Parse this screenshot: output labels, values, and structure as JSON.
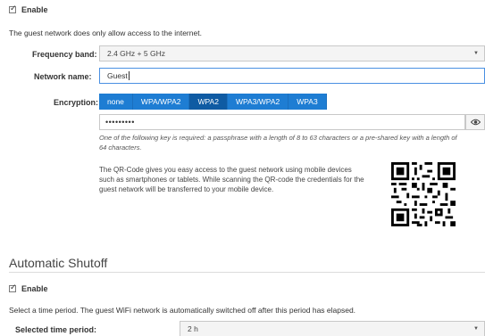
{
  "guest": {
    "enable_label": "Enable",
    "description": "The guest network does only allow access to the internet.",
    "frequency": {
      "label": "Frequency band:",
      "value": "2.4 GHz + 5 GHz"
    },
    "network_name": {
      "label": "Network name:",
      "value": "Guest"
    },
    "encryption": {
      "label": "Encryption:",
      "options": [
        "none",
        "WPA/WPA2",
        "WPA2",
        "WPA3/WPA2",
        "WPA3"
      ],
      "selected": "WPA2"
    },
    "password_mask": "•••••••••",
    "key_hint": "One of the following key is required: a passphrase with a length of 8 to 63 characters or a pre-shared key with a length of 64 characters.",
    "qr_text": "The QR-Code gives you easy access to the guest network using mobile devices such as smartphones or tablets. While scanning the QR-code the credentials for the guest network will be transferred to your mobile device."
  },
  "shutoff": {
    "title": "Automatic Shutoff",
    "enable_label": "Enable",
    "description": "Select a time period. The guest WiFi network is automatically switched off after this period has elapsed.",
    "period": {
      "label": "Selected time period:",
      "value": "2 h"
    }
  },
  "icons": {
    "eye": "eye-icon",
    "dropdown": "chevron-down-icon",
    "check": "checkmark-icon"
  },
  "colors": {
    "accent": "#1e7dd3",
    "accent_active": "#0f5ba3",
    "focus_border": "#4a90e2"
  }
}
